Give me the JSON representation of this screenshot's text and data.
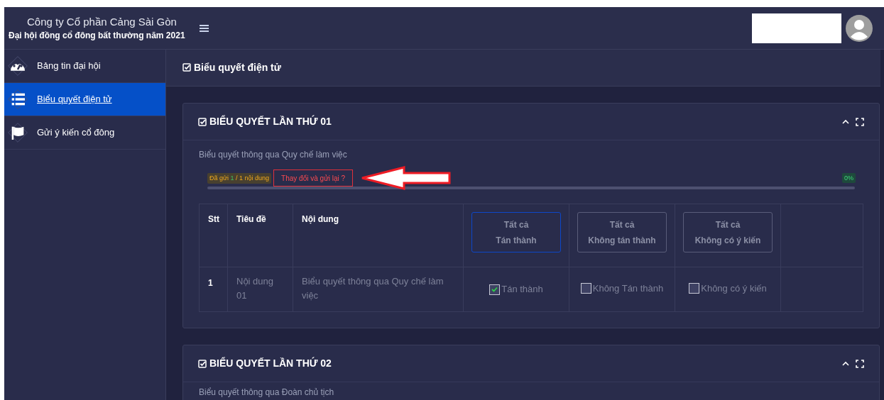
{
  "header": {
    "company": "Công ty Cổ phần Cảng Sài Gòn",
    "event": "Đại hội đồng cổ đông bất thường năm 2021"
  },
  "sidebar": {
    "items": [
      {
        "label": "Bảng tin đại hội",
        "kind": "dashboard",
        "selected": false
      },
      {
        "label": "Biểu quyết điện tử",
        "kind": "list",
        "selected": true
      },
      {
        "label": "Gửi ý kiến cổ đông",
        "kind": "flag",
        "selected": false
      }
    ]
  },
  "page_title": "Biểu quyết điện tử",
  "polls": [
    {
      "title": "BIỂU QUYẾT LẦN THỨ 01",
      "description": "Biểu quyết thông qua Quy chế làm việc",
      "sent_label": "Đã gửi",
      "sent_count": "1",
      "sent_total": "/ 1 nội dung",
      "resend_button": "Thay đổi và gửi lại ?",
      "level": 0,
      "progress_label": "0%",
      "columns": [
        "Stt",
        "Tiêu đề",
        "Nội dung"
      ],
      "all_buttons": [
        {
          "line1": "Tất cả",
          "line2": "Tán thành",
          "selected": true
        },
        {
          "line1": "Tất cả",
          "line2": "Không tán thành",
          "selected": false
        },
        {
          "line1": "Tất cả",
          "line2": "Không có ý kiến",
          "selected": false
        }
      ],
      "rows": [
        {
          "stt": "1",
          "title": "Nội dung 01",
          "content": "Biểu quyết thông qua Quy chế làm việc",
          "options": [
            {
              "label": "Tán thành",
              "checked": true
            },
            {
              "label": "Không Tán thành",
              "checked": false
            },
            {
              "label": "Không có ý kiến",
              "checked": false
            }
          ]
        }
      ]
    },
    {
      "title": "BIỂU QUYẾT LẦN THỨ 02",
      "description": "Biểu quyết thông qua Đoàn chủ tịch"
    }
  ]
}
